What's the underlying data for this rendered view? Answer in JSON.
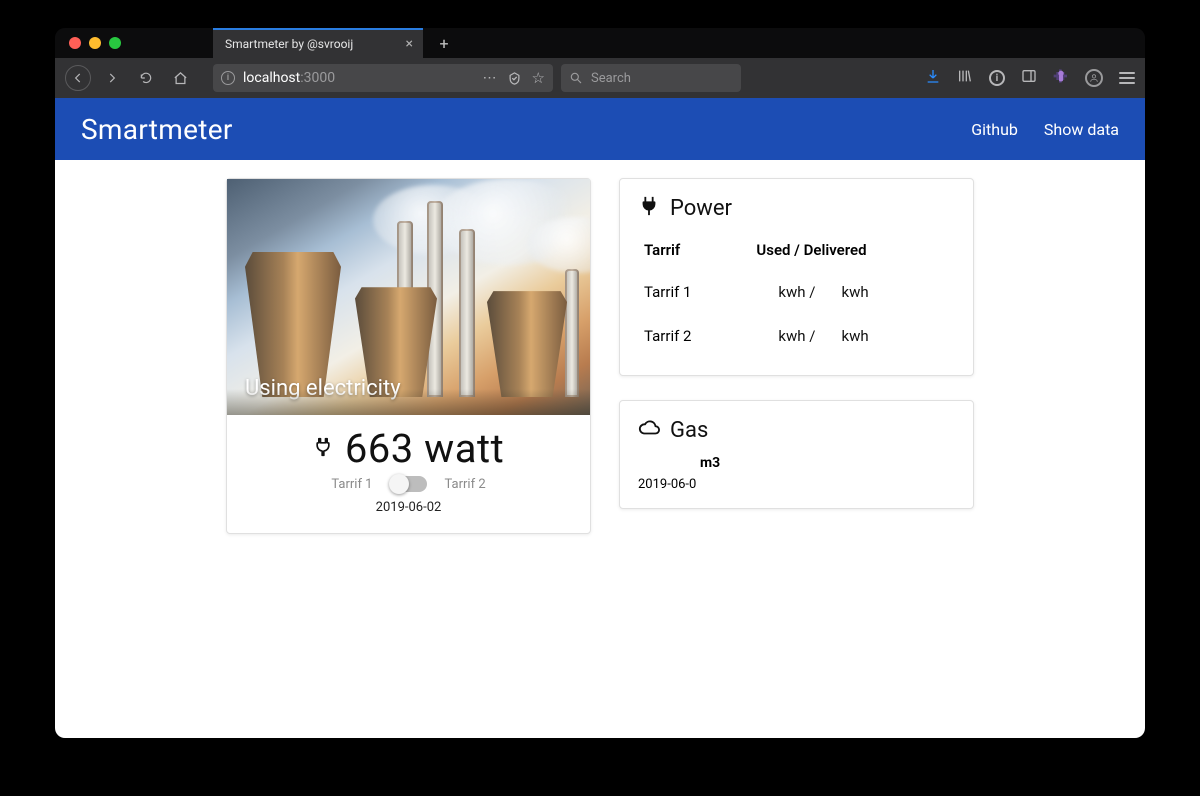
{
  "browser": {
    "tab_title": "Smartmeter by @svrooij",
    "url_host": "localhost",
    "url_port": ":3000",
    "search_placeholder": "Search"
  },
  "header": {
    "brand": "Smartmeter",
    "links": {
      "github": "Github",
      "show_data": "Show data"
    }
  },
  "electricity_card": {
    "overlay_title": "Using electricity",
    "watt_value": "663 watt",
    "tarrif1_label": "Tarrif 1",
    "tarrif2_label": "Tarrif 2",
    "date": "2019-06-02"
  },
  "power_card": {
    "title": "Power",
    "columns": {
      "tarrif": "Tarrif",
      "used_delivered": "Used / Delivered"
    },
    "rows": [
      {
        "tarrif": "Tarrif 1",
        "used": "kwh /",
        "delivered": "kwh"
      },
      {
        "tarrif": "Tarrif 2",
        "used": "kwh /",
        "delivered": "kwh"
      }
    ]
  },
  "gas_card": {
    "title": "Gas",
    "unit": "m3",
    "date": "2019-06-0"
  }
}
